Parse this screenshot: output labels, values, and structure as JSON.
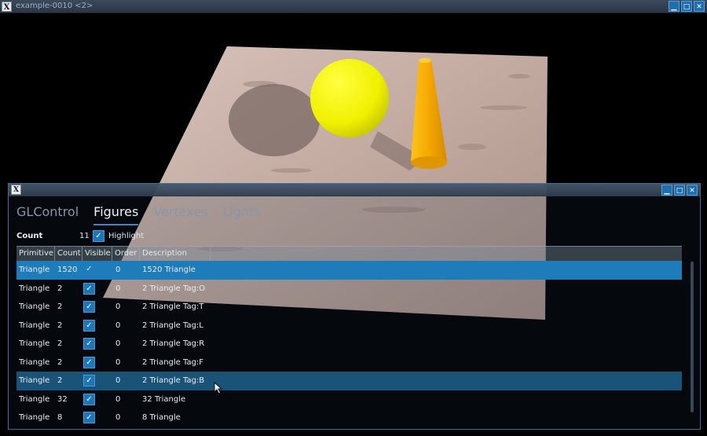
{
  "window": {
    "title": "example-0010 <2>",
    "logo": "X"
  },
  "window_buttons": {
    "minimize": "▁",
    "maximize": "□",
    "close": "✕"
  },
  "inner_window": {
    "logo": "X"
  },
  "tabs": [
    {
      "label": "GLControl",
      "active": false
    },
    {
      "label": "Figures",
      "active": true
    },
    {
      "label": "Vertexes",
      "active": false
    },
    {
      "label": "Lights",
      "active": false
    }
  ],
  "toolbar": {
    "count_label": "Count",
    "count_value": "11",
    "highlight_label": "Highlight",
    "highlight_checked": true
  },
  "table": {
    "columns": [
      "Primitive",
      "Count",
      "Visible",
      "Order",
      "Description"
    ],
    "rows": [
      {
        "primitive": "Triangle",
        "count": "1520",
        "visible": true,
        "order": "0",
        "description": "1520 Triangle",
        "state": "selected"
      },
      {
        "primitive": "Triangle",
        "count": "2",
        "visible": true,
        "order": "0",
        "description": "2 Triangle  Tag:O",
        "state": ""
      },
      {
        "primitive": "Triangle",
        "count": "2",
        "visible": true,
        "order": "0",
        "description": "2 Triangle  Tag:T",
        "state": ""
      },
      {
        "primitive": "Triangle",
        "count": "2",
        "visible": true,
        "order": "0",
        "description": "2 Triangle  Tag:L",
        "state": ""
      },
      {
        "primitive": "Triangle",
        "count": "2",
        "visible": true,
        "order": "0",
        "description": "2 Triangle  Tag:R",
        "state": ""
      },
      {
        "primitive": "Triangle",
        "count": "2",
        "visible": true,
        "order": "0",
        "description": "2 Triangle  Tag:F",
        "state": ""
      },
      {
        "primitive": "Triangle",
        "count": "2",
        "visible": true,
        "order": "0",
        "description": "2 Triangle  Tag:B",
        "state": "hover"
      },
      {
        "primitive": "Triangle",
        "count": "32",
        "visible": true,
        "order": "0",
        "description": "32 Triangle",
        "state": ""
      },
      {
        "primitive": "Triangle",
        "count": "8",
        "visible": true,
        "order": "0",
        "description": "8 Triangle",
        "state": ""
      }
    ]
  },
  "scene": {
    "objects": [
      "textured-ground-plane",
      "yellow-sphere",
      "orange-cone",
      "sphere-shadow"
    ],
    "colors": {
      "sphere": "#f2f200",
      "cone": "#f5a800",
      "ground": "#c9b2a8",
      "background": "#000000"
    }
  },
  "icons": {
    "check": "✓"
  }
}
